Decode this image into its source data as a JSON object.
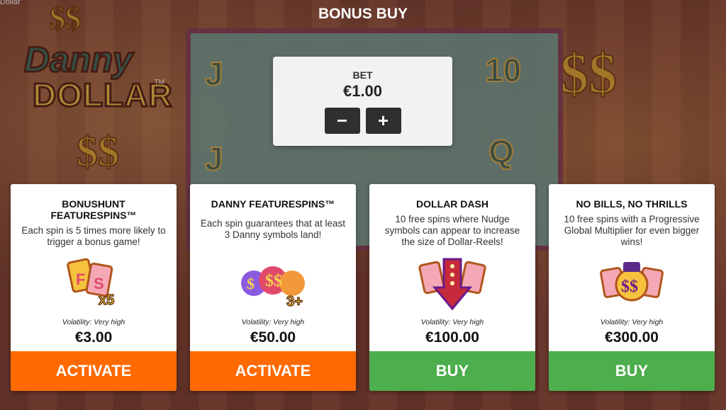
{
  "window": {
    "label": "Dollar"
  },
  "logo": {
    "line1": "Danny",
    "line2": "DOLLAR",
    "tm": "TM"
  },
  "title": "BONUS BUY",
  "reels": {
    "symbols": [
      "J",
      "J",
      "10",
      "Q"
    ]
  },
  "bet": {
    "label": "BET",
    "value": "€1.00",
    "minus": "−",
    "plus": "+"
  },
  "cards": [
    {
      "name": "BONUSHUNT FEATURESPINS™",
      "description": "Each spin is 5 times more likely to trigger a bonus game!",
      "icon": "fs-cards-x5-icon",
      "volatility": "Volatility: Very high",
      "price": "€3.00",
      "action": "ACTIVATE",
      "action_color": "#ff6a00"
    },
    {
      "name": "DANNY FEATURESPINS™",
      "description": "Each spin guarantees that at least 3 Danny symbols land!",
      "icon": "danny-symbols-3plus-icon",
      "volatility": "Volatility: Very high",
      "price": "€50.00",
      "action": "ACTIVATE",
      "action_color": "#ff6a00"
    },
    {
      "name": "DOLLAR DASH",
      "description": "10 free spins where Nudge symbols can appear to increase the size of Dollar-Reels!",
      "icon": "nudge-arrow-icon",
      "volatility": "Volatility: Very high",
      "price": "€100.00",
      "action": "BUY",
      "action_color": "#4cae4c"
    },
    {
      "name": "NO BILLS, NO THRILLS",
      "description": "10 free spins with a Progressive Global Multiplier for even bigger wins!",
      "icon": "danny-dollar-cards-icon",
      "volatility": "Volatility: Very high",
      "price": "€300.00",
      "action": "BUY",
      "action_color": "#4cae4c"
    }
  ]
}
